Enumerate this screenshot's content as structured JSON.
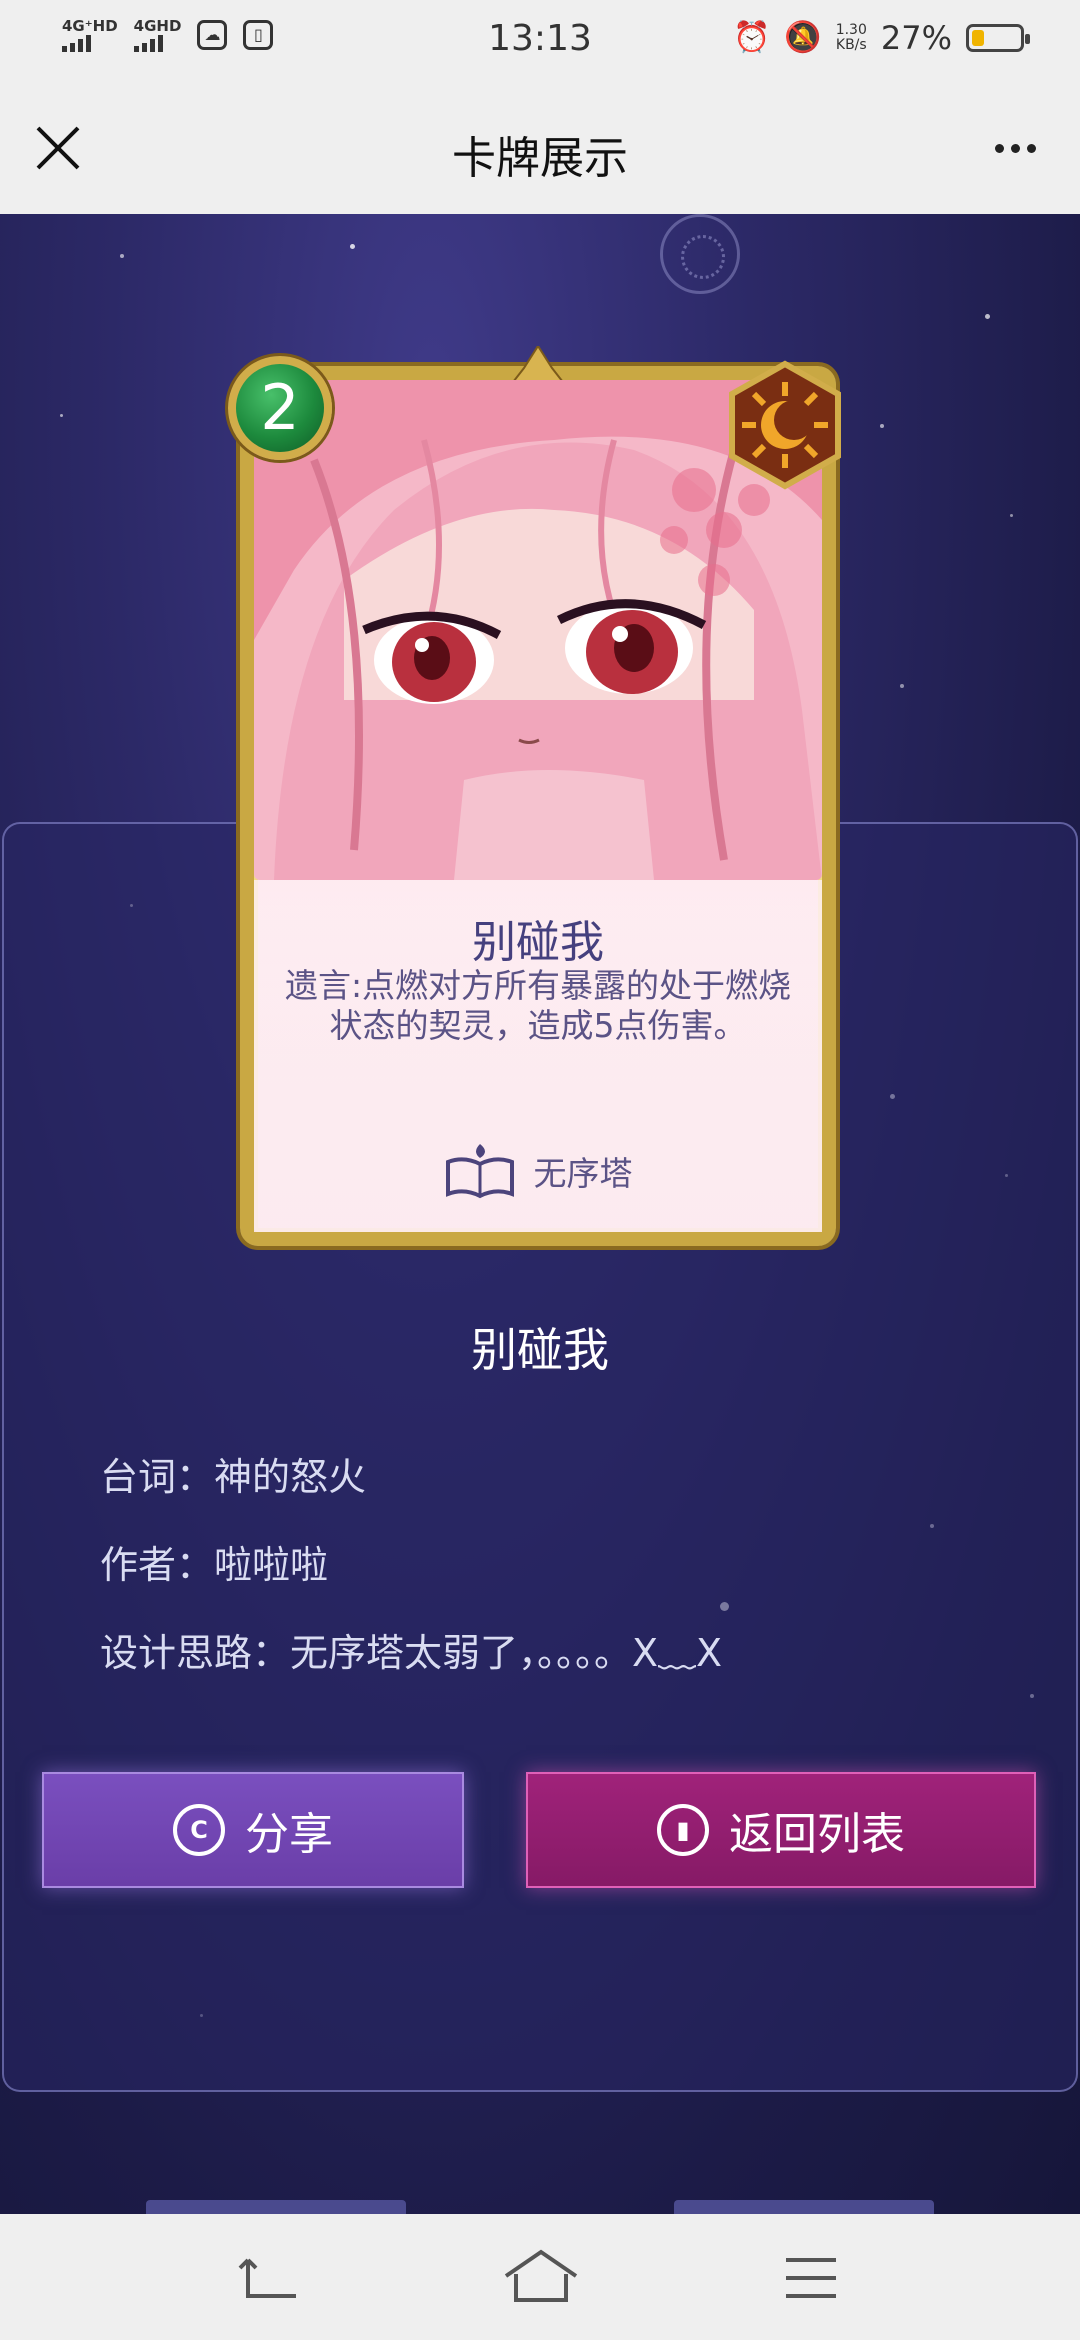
{
  "status_bar": {
    "sim1_label": "4G⁺HD",
    "sim2_label": "4GHD",
    "app_icon_1": "cloud-icon",
    "app_icon_2": "app-icon",
    "time": "13:13",
    "alarm_icon": "alarm-icon",
    "mute_icon": "bell-off-icon",
    "net_speed_value": "1.30",
    "net_speed_unit": "KB/s",
    "battery_percent": "27%",
    "battery_level": 0.27,
    "battery_color": "#f0b400"
  },
  "title_bar": {
    "title": "卡牌展示",
    "close_icon": "close-icon",
    "more_icon": "more-icon"
  },
  "card": {
    "cost": "2",
    "name": "别碰我",
    "description": "遗言:点燃对方所有暴露的处于燃烧状态的契灵，造成5点伤害。",
    "faction": "无序塔",
    "faction_icon": "book-icon",
    "element_icon": "sun-moon-icon"
  },
  "info": {
    "title": "别碰我",
    "line_label_quote": "台词：",
    "quote": "神的怒火",
    "line_label_author": "作者：",
    "author": "啦啦啦",
    "line_label_design": "设计思路：",
    "design": "无序塔太弱了，。。。。X﹏X"
  },
  "buttons": {
    "share_label": "分享",
    "share_icon": "share-icon",
    "back_label": "返回列表",
    "back_icon": "cards-icon",
    "share_color": "#6a3ea8",
    "back_color": "#861a66"
  },
  "nav_bar": {
    "back_icon": "back-icon",
    "home_icon": "home-icon",
    "menu_icon": "menu-icon"
  }
}
